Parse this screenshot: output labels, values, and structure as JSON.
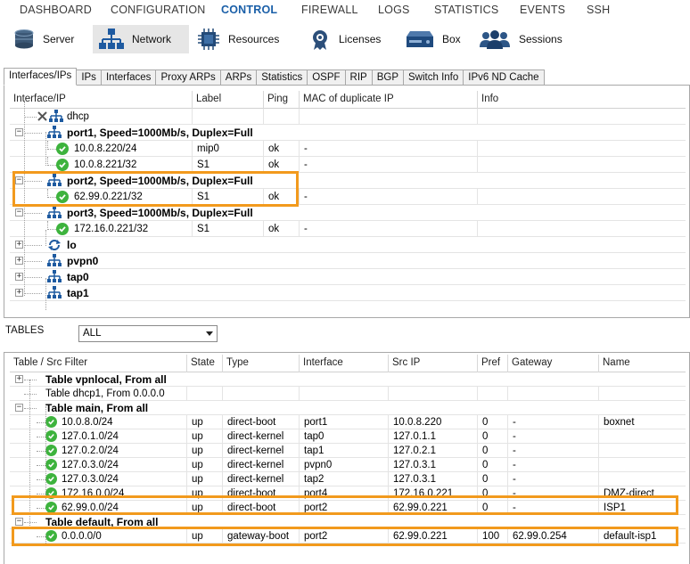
{
  "topmenu": {
    "items": [
      {
        "label": "DASHBOARD"
      },
      {
        "label": "CONFIGURATION"
      },
      {
        "label": "CONTROL"
      },
      {
        "label": "FIREWALL"
      },
      {
        "label": "LOGS"
      },
      {
        "label": "STATISTICS"
      },
      {
        "label": "EVENTS"
      },
      {
        "label": "SSH"
      }
    ],
    "active": "CONTROL"
  },
  "toolbar": {
    "items": [
      {
        "label": "Server",
        "icon": "server-icon"
      },
      {
        "label": "Network",
        "icon": "network-icon"
      },
      {
        "label": "Resources",
        "icon": "chip-icon"
      },
      {
        "label": "Licenses",
        "icon": "license-icon"
      },
      {
        "label": "Box",
        "icon": "box-icon"
      },
      {
        "label": "Sessions",
        "icon": "users-icon"
      }
    ],
    "active": "Network"
  },
  "tabs": [
    "Interfaces/IPs",
    "IPs",
    "Interfaces",
    "Proxy ARPs",
    "ARPs",
    "Statistics",
    "OSPF",
    "RIP",
    "BGP",
    "Switch Info",
    "IPv6 ND Cache"
  ],
  "interfaces": {
    "columns": [
      "Interface/IP",
      "Label",
      "Ping",
      "MAC of duplicate IP",
      "Info"
    ],
    "rows": [
      {
        "name": "dhcp",
        "label": "",
        "ping": "",
        "mac": "",
        "bold": false
      },
      {
        "name": "port1, Speed=1000Mb/s, Duplex=Full",
        "label": "",
        "ping": "",
        "mac": "",
        "bold": true
      },
      {
        "name": "10.0.8.220/24",
        "label": "mip0",
        "ping": "ok",
        "mac": "-",
        "bold": false
      },
      {
        "name": "10.0.8.221/32",
        "label": "S1",
        "ping": "ok",
        "mac": "-",
        "bold": false
      },
      {
        "name": "port2, Speed=1000Mb/s, Duplex=Full",
        "label": "",
        "ping": "",
        "mac": "",
        "bold": true
      },
      {
        "name": "62.99.0.221/32",
        "label": "S1",
        "ping": "ok",
        "mac": "-",
        "bold": false
      },
      {
        "name": "port3, Speed=1000Mb/s, Duplex=Full",
        "label": "",
        "ping": "",
        "mac": "",
        "bold": true
      },
      {
        "name": "172.16.0.221/32",
        "label": "S1",
        "ping": "ok",
        "mac": "-",
        "bold": false
      },
      {
        "name": "lo",
        "label": "",
        "ping": "",
        "mac": "",
        "bold": true
      },
      {
        "name": "pvpn0",
        "label": "",
        "ping": "",
        "mac": "",
        "bold": true
      },
      {
        "name": "tap0",
        "label": "",
        "ping": "",
        "mac": "",
        "bold": true
      },
      {
        "name": "tap1",
        "label": "",
        "ping": "",
        "mac": "",
        "bold": true
      }
    ]
  },
  "tables_filter": {
    "label": "TABLES",
    "value": "ALL"
  },
  "routes": {
    "columns": [
      "Table / Src Filter",
      "State",
      "Type",
      "Interface",
      "Src IP",
      "Pref",
      "Gateway",
      "Name"
    ],
    "rows": [
      {
        "dest": "Table vpnlocal, From all",
        "state": "",
        "type": "",
        "iface": "",
        "src": "",
        "pref": "",
        "gw": "",
        "name": "",
        "bold": true
      },
      {
        "dest": "Table dhcp1, From 0.0.0.0",
        "state": "",
        "type": "",
        "iface": "",
        "src": "",
        "pref": "",
        "gw": "",
        "name": "",
        "bold": false
      },
      {
        "dest": "Table main, From all",
        "state": "",
        "type": "",
        "iface": "",
        "src": "",
        "pref": "",
        "gw": "",
        "name": "",
        "bold": true
      },
      {
        "dest": "10.0.8.0/24",
        "state": "up",
        "type": "direct-boot",
        "iface": "port1",
        "src": "10.0.8.220",
        "pref": "0",
        "gw": "-",
        "name": "boxnet",
        "bold": false
      },
      {
        "dest": "127.0.1.0/24",
        "state": "up",
        "type": "direct-kernel",
        "iface": "tap0",
        "src": "127.0.1.1",
        "pref": "0",
        "gw": "-",
        "name": "",
        "bold": false
      },
      {
        "dest": "127.0.2.0/24",
        "state": "up",
        "type": "direct-kernel",
        "iface": "tap1",
        "src": "127.0.2.1",
        "pref": "0",
        "gw": "-",
        "name": "",
        "bold": false
      },
      {
        "dest": "127.0.3.0/24",
        "state": "up",
        "type": "direct-kernel",
        "iface": "pvpn0",
        "src": "127.0.3.1",
        "pref": "0",
        "gw": "-",
        "name": "",
        "bold": false
      },
      {
        "dest": "127.0.3.0/24",
        "state": "up",
        "type": "direct-kernel",
        "iface": "tap2",
        "src": "127.0.3.1",
        "pref": "0",
        "gw": "-",
        "name": "",
        "bold": false
      },
      {
        "dest": "172.16.0.0/24",
        "state": "up",
        "type": "direct-boot",
        "iface": "port4",
        "src": "172.16.0.221",
        "pref": "0",
        "gw": "-",
        "name": "DMZ-direct",
        "bold": false
      },
      {
        "dest": "62.99.0.0/24",
        "state": "up",
        "type": "direct-boot",
        "iface": "port2",
        "src": "62.99.0.221",
        "pref": "0",
        "gw": "-",
        "name": "ISP1",
        "bold": false
      },
      {
        "dest": "Table default, From all",
        "state": "",
        "type": "",
        "iface": "",
        "src": "",
        "pref": "",
        "gw": "",
        "name": "",
        "bold": true
      },
      {
        "dest": "0.0.0.0/0",
        "state": "up",
        "type": "gateway-boot",
        "iface": "port2",
        "src": "62.99.0.221",
        "pref": "100",
        "gw": "62.99.0.254",
        "name": "default-isp1",
        "bold": false
      }
    ]
  },
  "colors": {
    "accent": "#1a5fa8",
    "highlight": "#f29a1d",
    "ok": "#3db33d",
    "network_icon": "#1e5aa0"
  }
}
